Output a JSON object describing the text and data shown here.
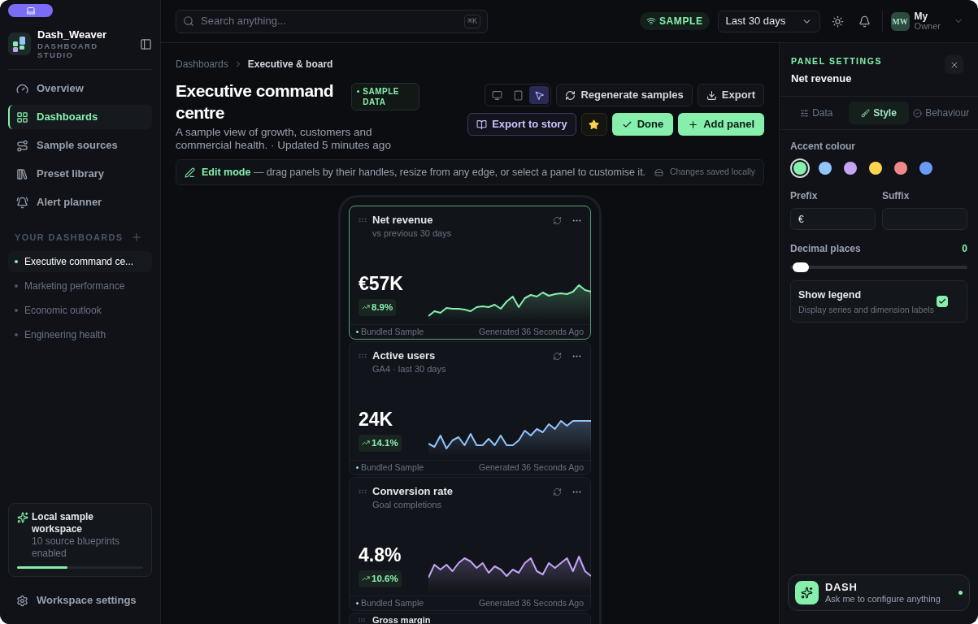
{
  "brand": {
    "name": "Dash_Weaver",
    "subtitle": "DASHBOARD STUDIO"
  },
  "nav": [
    {
      "label": "Overview",
      "selected": false
    },
    {
      "label": "Dashboards",
      "selected": true
    },
    {
      "label": "Sample sources",
      "selected": false
    },
    {
      "label": "Preset library",
      "selected": false
    },
    {
      "label": "Alert planner",
      "selected": false
    }
  ],
  "dashboards_heading": "YOUR DASHBOARDS",
  "dashboards": [
    {
      "label": "Executive command ce...",
      "selected": true
    },
    {
      "label": "Marketing performance",
      "selected": false
    },
    {
      "label": "Economic outlook",
      "selected": false
    },
    {
      "label": "Engineering health",
      "selected": false
    }
  ],
  "workspace_card": {
    "title": "Local sample workspace",
    "subtitle": "10 source blueprints enabled",
    "level": 0.4
  },
  "workspace_settings": "Workspace settings",
  "topbar": {
    "search_placeholder": "Search anything...",
    "shortcut": "⌘K",
    "sample_badge": "SAMPLE",
    "range": "Last 30 days",
    "user_initials": "MW",
    "user_name": "My",
    "user_role": "Owner"
  },
  "breadcrumb": [
    "Dashboards",
    "Executive & board"
  ],
  "page": {
    "title": "Executive command centre",
    "badge": "SAMPLE DATA",
    "description": "A sample view of growth, customers and commercial health. · Updated 5 minutes ago"
  },
  "devices": [
    {
      "selected": false
    },
    {
      "selected": false
    },
    {
      "selected": true
    }
  ],
  "actions": {
    "regenerate": "Regenerate samples",
    "export": "Export",
    "story": "Export to story",
    "done": "Done",
    "add": "Add panel"
  },
  "edit_notice": {
    "text": "**Edit mode** — drag panels by their handles, resize from any edge, or select a panel to customise it.",
    "saved": "Changes saved locally"
  },
  "panels": [
    {
      "title": "Net revenue",
      "subtitle": "vs previous 30 days",
      "value": "€57K",
      "change": "8.9%",
      "color": "#86efac",
      "selected": true,
      "source": "Bundled Sample",
      "generated": "Generated 36 Seconds Ago"
    },
    {
      "title": "Active users",
      "subtitle": "GA4 · last 30 days",
      "value": "24K",
      "change": "14.1%",
      "color": "#93c5fd",
      "selected": false,
      "source": "Bundled Sample",
      "generated": "Generated 36 Seconds Ago"
    },
    {
      "title": "Conversion rate",
      "subtitle": "Goal completions",
      "value": "4.8%",
      "change": "10.6%",
      "color": "#c4a5f5",
      "selected": false,
      "source": "Bundled Sample",
      "generated": "Generated 36 Seconds Ago"
    },
    {
      "title": "Gross margin"
    }
  ],
  "settings": {
    "heading": "PANEL SETTINGS",
    "panel": "Net revenue",
    "tabs": [
      {
        "label": "Data",
        "selected": false
      },
      {
        "label": "Style",
        "selected": true
      },
      {
        "label": "Behaviour",
        "selected": false
      }
    ],
    "accent_label": "Accent colour",
    "accents": [
      {
        "color": "#86efac",
        "selected": true
      },
      {
        "color": "#93c5fd",
        "selected": false
      },
      {
        "color": "#c4a5f5",
        "selected": false
      },
      {
        "color": "#fcd34d",
        "selected": false
      },
      {
        "color": "#f08a8a",
        "selected": false
      },
      {
        "color": "#6b9cf5",
        "selected": false
      }
    ],
    "prefix_label": "Prefix",
    "prefix": "€",
    "suffix_label": "Suffix",
    "decimals_label": "Decimal places",
    "decimals": "0",
    "decimals_slider": {
      "level": 0
    },
    "legend_title": "Show legend",
    "legend_desc": "Display series and dimension labels",
    "legend_checked": true
  },
  "assistant": {
    "name": "DASH",
    "hint": "Ask me to configure anything"
  }
}
